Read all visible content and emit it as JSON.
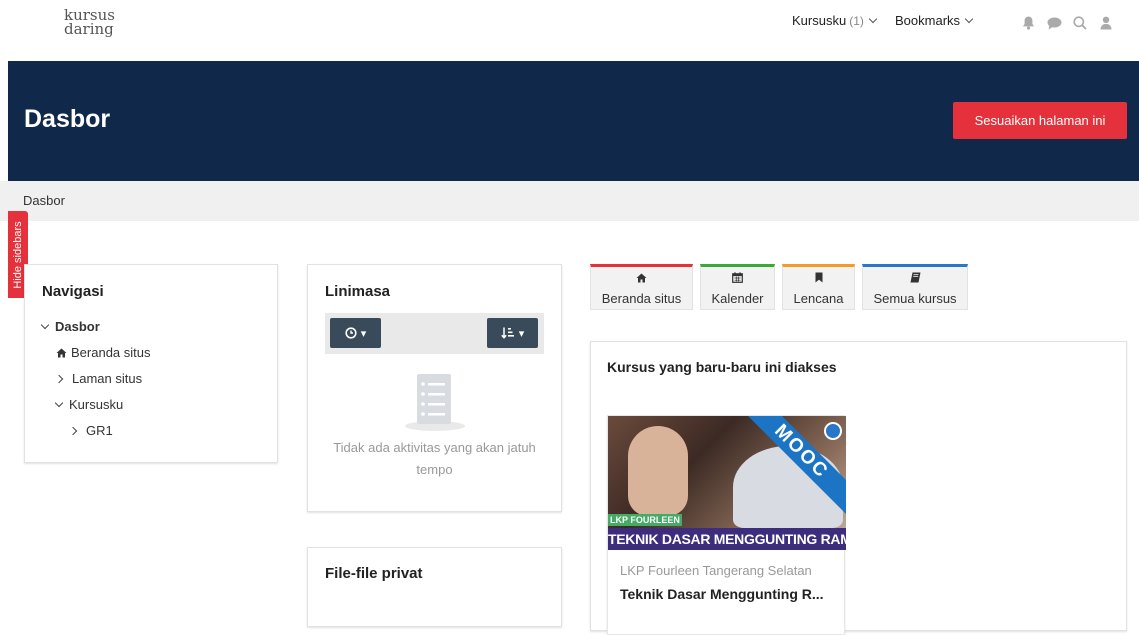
{
  "brand": {
    "logo_line1": "kursus",
    "logo_line2": "daring"
  },
  "topnav": {
    "mycourses_label": "Kursusku",
    "mycourses_count": "(1)",
    "bookmarks_label": "Bookmarks",
    "icons": [
      "bell-icon",
      "chat-icon",
      "search-icon",
      "user-icon"
    ]
  },
  "header": {
    "title": "Dasbor",
    "customize_label": "Sesuaikan halaman ini"
  },
  "breadcrumb": {
    "current": "Dasbor"
  },
  "sidebar_toggle": {
    "label": "Hide sidebars"
  },
  "navigation": {
    "title": "Navigasi",
    "items": [
      {
        "label": "Dasbor"
      },
      {
        "label": "Beranda situs"
      },
      {
        "label": "Laman situs"
      },
      {
        "label": "Kursusku"
      },
      {
        "label": "GR1"
      }
    ]
  },
  "timeline": {
    "title": "Linimasa",
    "empty_text": "Tidak ada aktivitas yang akan jatuh tempo"
  },
  "private_files": {
    "title": "File-file privat"
  },
  "quick_links": [
    {
      "label": "Beranda situs",
      "icon": "home-icon",
      "color": "#e4313b"
    },
    {
      "label": "Kalender",
      "icon": "calendar-icon",
      "color": "#3aa935"
    },
    {
      "label": "Lencana",
      "icon": "bookmark-icon",
      "color": "#f59a23"
    },
    {
      "label": "Semua kursus",
      "icon": "book-icon",
      "color": "#2a77c9"
    }
  ],
  "recent_courses": {
    "title": "Kursus yang baru-baru ini diakses",
    "courses": [
      {
        "category": "LKP Fourleen Tangerang Selatan",
        "name": "Teknik Dasar Menggunting R...",
        "image_banner": "TEKNIK DASAR MENGGUNTING RAMBUT",
        "image_ribbon": "MOOC",
        "image_logo": "LKP FOURLEEN"
      }
    ]
  },
  "colors": {
    "header_bg": "#10294a",
    "accent_red": "#e4313b",
    "breadcrumb_bg": "#f0f0f0"
  }
}
